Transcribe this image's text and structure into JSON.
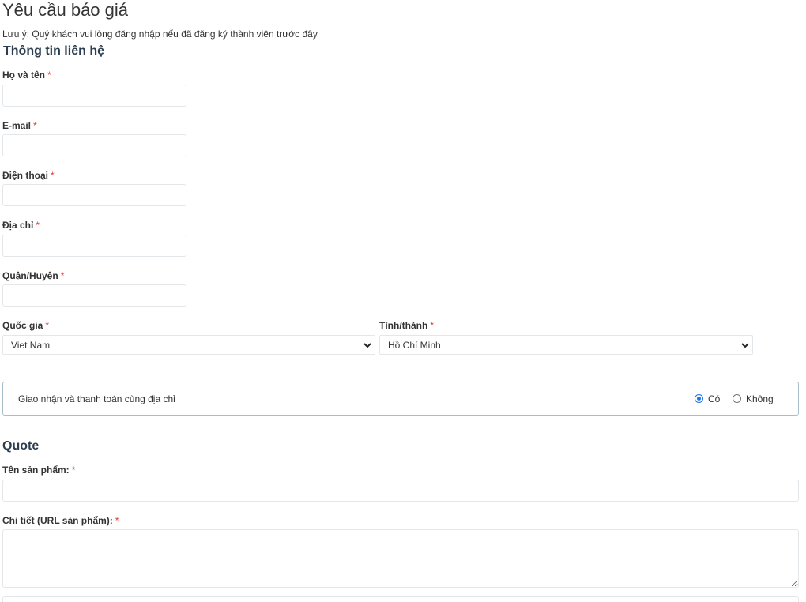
{
  "page": {
    "title": "Yêu cầu báo giá",
    "note": "Lưu ý: Quý khách vui lòng đăng nhập nếu đã đăng ký thành viên trước đây"
  },
  "contact": {
    "heading": "Thông tin liên hệ",
    "required_mark": "*",
    "fields": [
      {
        "label": "Họ và tên",
        "value": ""
      },
      {
        "label": "E-mail",
        "value": ""
      },
      {
        "label": "Điện thoại",
        "value": ""
      },
      {
        "label": "Địa chỉ",
        "value": ""
      },
      {
        "label": "Quận/Huyện",
        "value": ""
      }
    ],
    "country": {
      "label": "Quốc gia",
      "value": "Viet Nam"
    },
    "province": {
      "label": "Tỉnh/thành",
      "value": "Hồ Chí Minh"
    }
  },
  "same_address": {
    "text": "Giao nhận và thanh toán cùng địa chỉ",
    "yes_label": "Có",
    "no_label": "Không",
    "selected": "yes"
  },
  "quote": {
    "heading": "Quote",
    "product_name_label": "Tên sản phẩm:",
    "detail_label": "Chi tiết (URL sản phẩm):"
  },
  "colors": {
    "required": "#e53935",
    "radio_checked": "#1a73e8",
    "panel_border": "#a7bdcc",
    "input_border": "#e4e7ea"
  }
}
